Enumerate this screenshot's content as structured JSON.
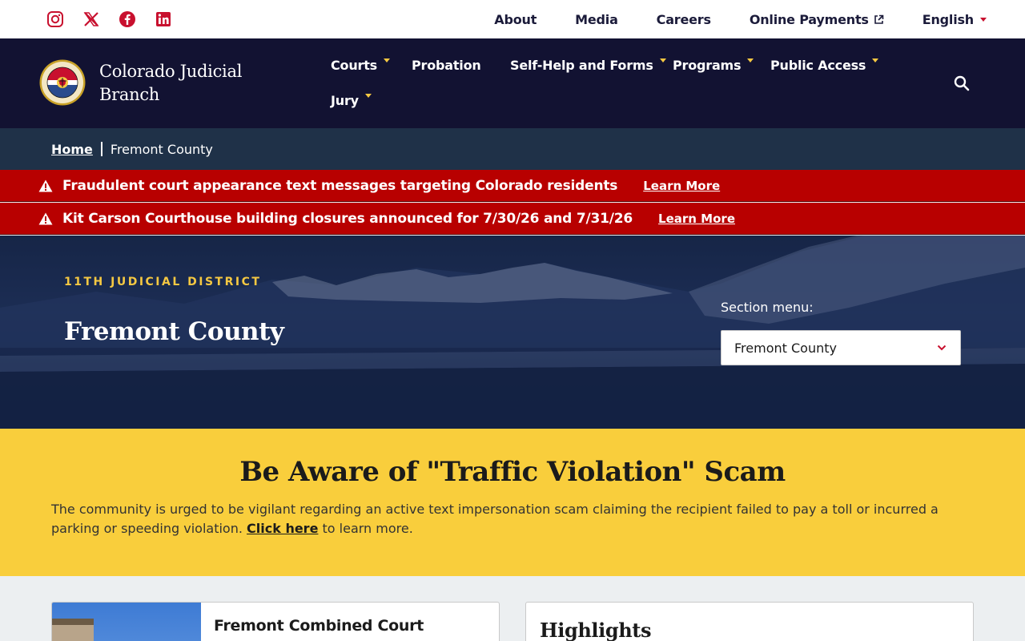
{
  "utility": {
    "social": [
      {
        "name": "instagram-icon"
      },
      {
        "name": "x-icon"
      },
      {
        "name": "facebook-icon"
      },
      {
        "name": "linkedin-icon"
      }
    ],
    "links": {
      "about": "About",
      "media": "Media",
      "careers": "Careers",
      "payments": "Online Payments",
      "language": "English"
    }
  },
  "header": {
    "site_name_line1": "Colorado Judicial",
    "site_name_line2": "Branch",
    "nav": {
      "courts": "Courts",
      "probation": "Probation",
      "self_help": "Self-Help and Forms",
      "programs": "Programs",
      "public_access": "Public Access",
      "jury": "Jury"
    }
  },
  "breadcrumb": {
    "home": "Home",
    "current": "Fremont County"
  },
  "alerts": [
    {
      "message": "Fraudulent court appearance text messages targeting Colorado residents",
      "link": "Learn More"
    },
    {
      "message": "Kit Carson Courthouse building closures announced for 7/30/26 and 7/31/26",
      "link": "Learn More"
    }
  ],
  "hero": {
    "district": "11TH JUDICIAL DISTRICT",
    "title": "Fremont County",
    "section_label": "Section menu:",
    "section_value": "Fremont County"
  },
  "scam": {
    "heading": "Be Aware of \"Traffic Violation\" Scam",
    "text_before": "The community is urged to be vigilant regarding an active text impersonation scam claiming the recipient failed to pay a toll or incurred a parking or speeding violation. ",
    "link": "Click here",
    "text_after": " to learn more."
  },
  "cards": {
    "court_title": "Fremont Combined Court",
    "highlights_title": "Highlights"
  },
  "colors": {
    "navy": "#121232",
    "breadcrumb": "#1f3148",
    "alert_red": "#b80000",
    "gold": "#f5c842",
    "scam_yellow": "#f9ce3c",
    "social_red": "#c8102e"
  }
}
